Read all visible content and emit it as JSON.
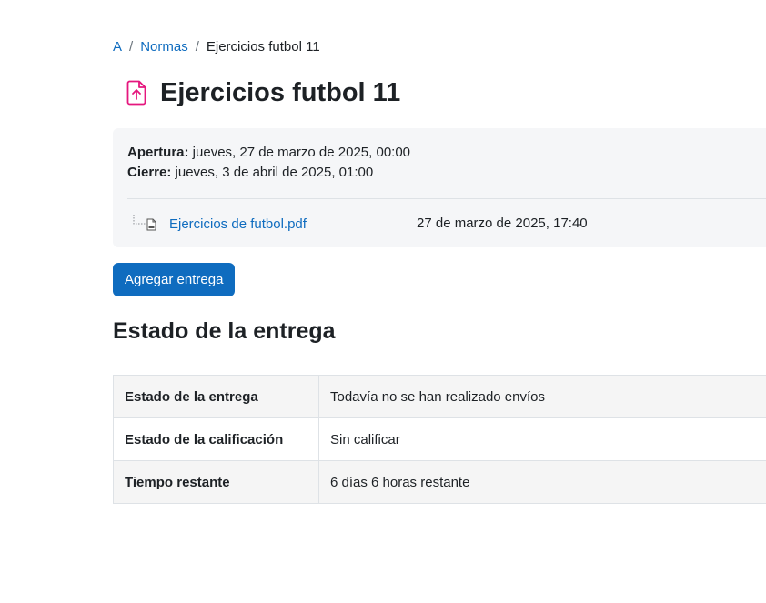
{
  "breadcrumb": {
    "items": [
      "A",
      "Normas"
    ],
    "separator": "/",
    "current": "Ejercicios futbol 11"
  },
  "header": {
    "icon": "assignment-upload-icon",
    "icon_color": "#e5177e",
    "title": "Ejercicios futbol 11"
  },
  "dates": {
    "opening_label": "Apertura:",
    "opening_value": " jueves, 27 de marzo de 2025, 00:00",
    "closing_label": "Cierre:",
    "closing_value": " jueves, 3 de abril de 2025, 01:00"
  },
  "attachment": {
    "icon": "pdf-file-icon",
    "name": "Ejercicios de futbol.pdf",
    "date": "27 de marzo de 2025, 17:40"
  },
  "actions": {
    "add_submission": "Agregar entrega"
  },
  "submission_status": {
    "title": "Estado de la entrega",
    "rows": [
      {
        "label": "Estado de la entrega",
        "value": "Todavía no se han realizado envíos"
      },
      {
        "label": "Estado de la calificación",
        "value": "Sin calificar"
      },
      {
        "label": "Tiempo restante",
        "value": "6 días 6 horas restante"
      }
    ]
  },
  "colors": {
    "link": "#0f6cbf",
    "primary_button": "#0f6cbf",
    "panel_background": "#f5f6f8"
  }
}
